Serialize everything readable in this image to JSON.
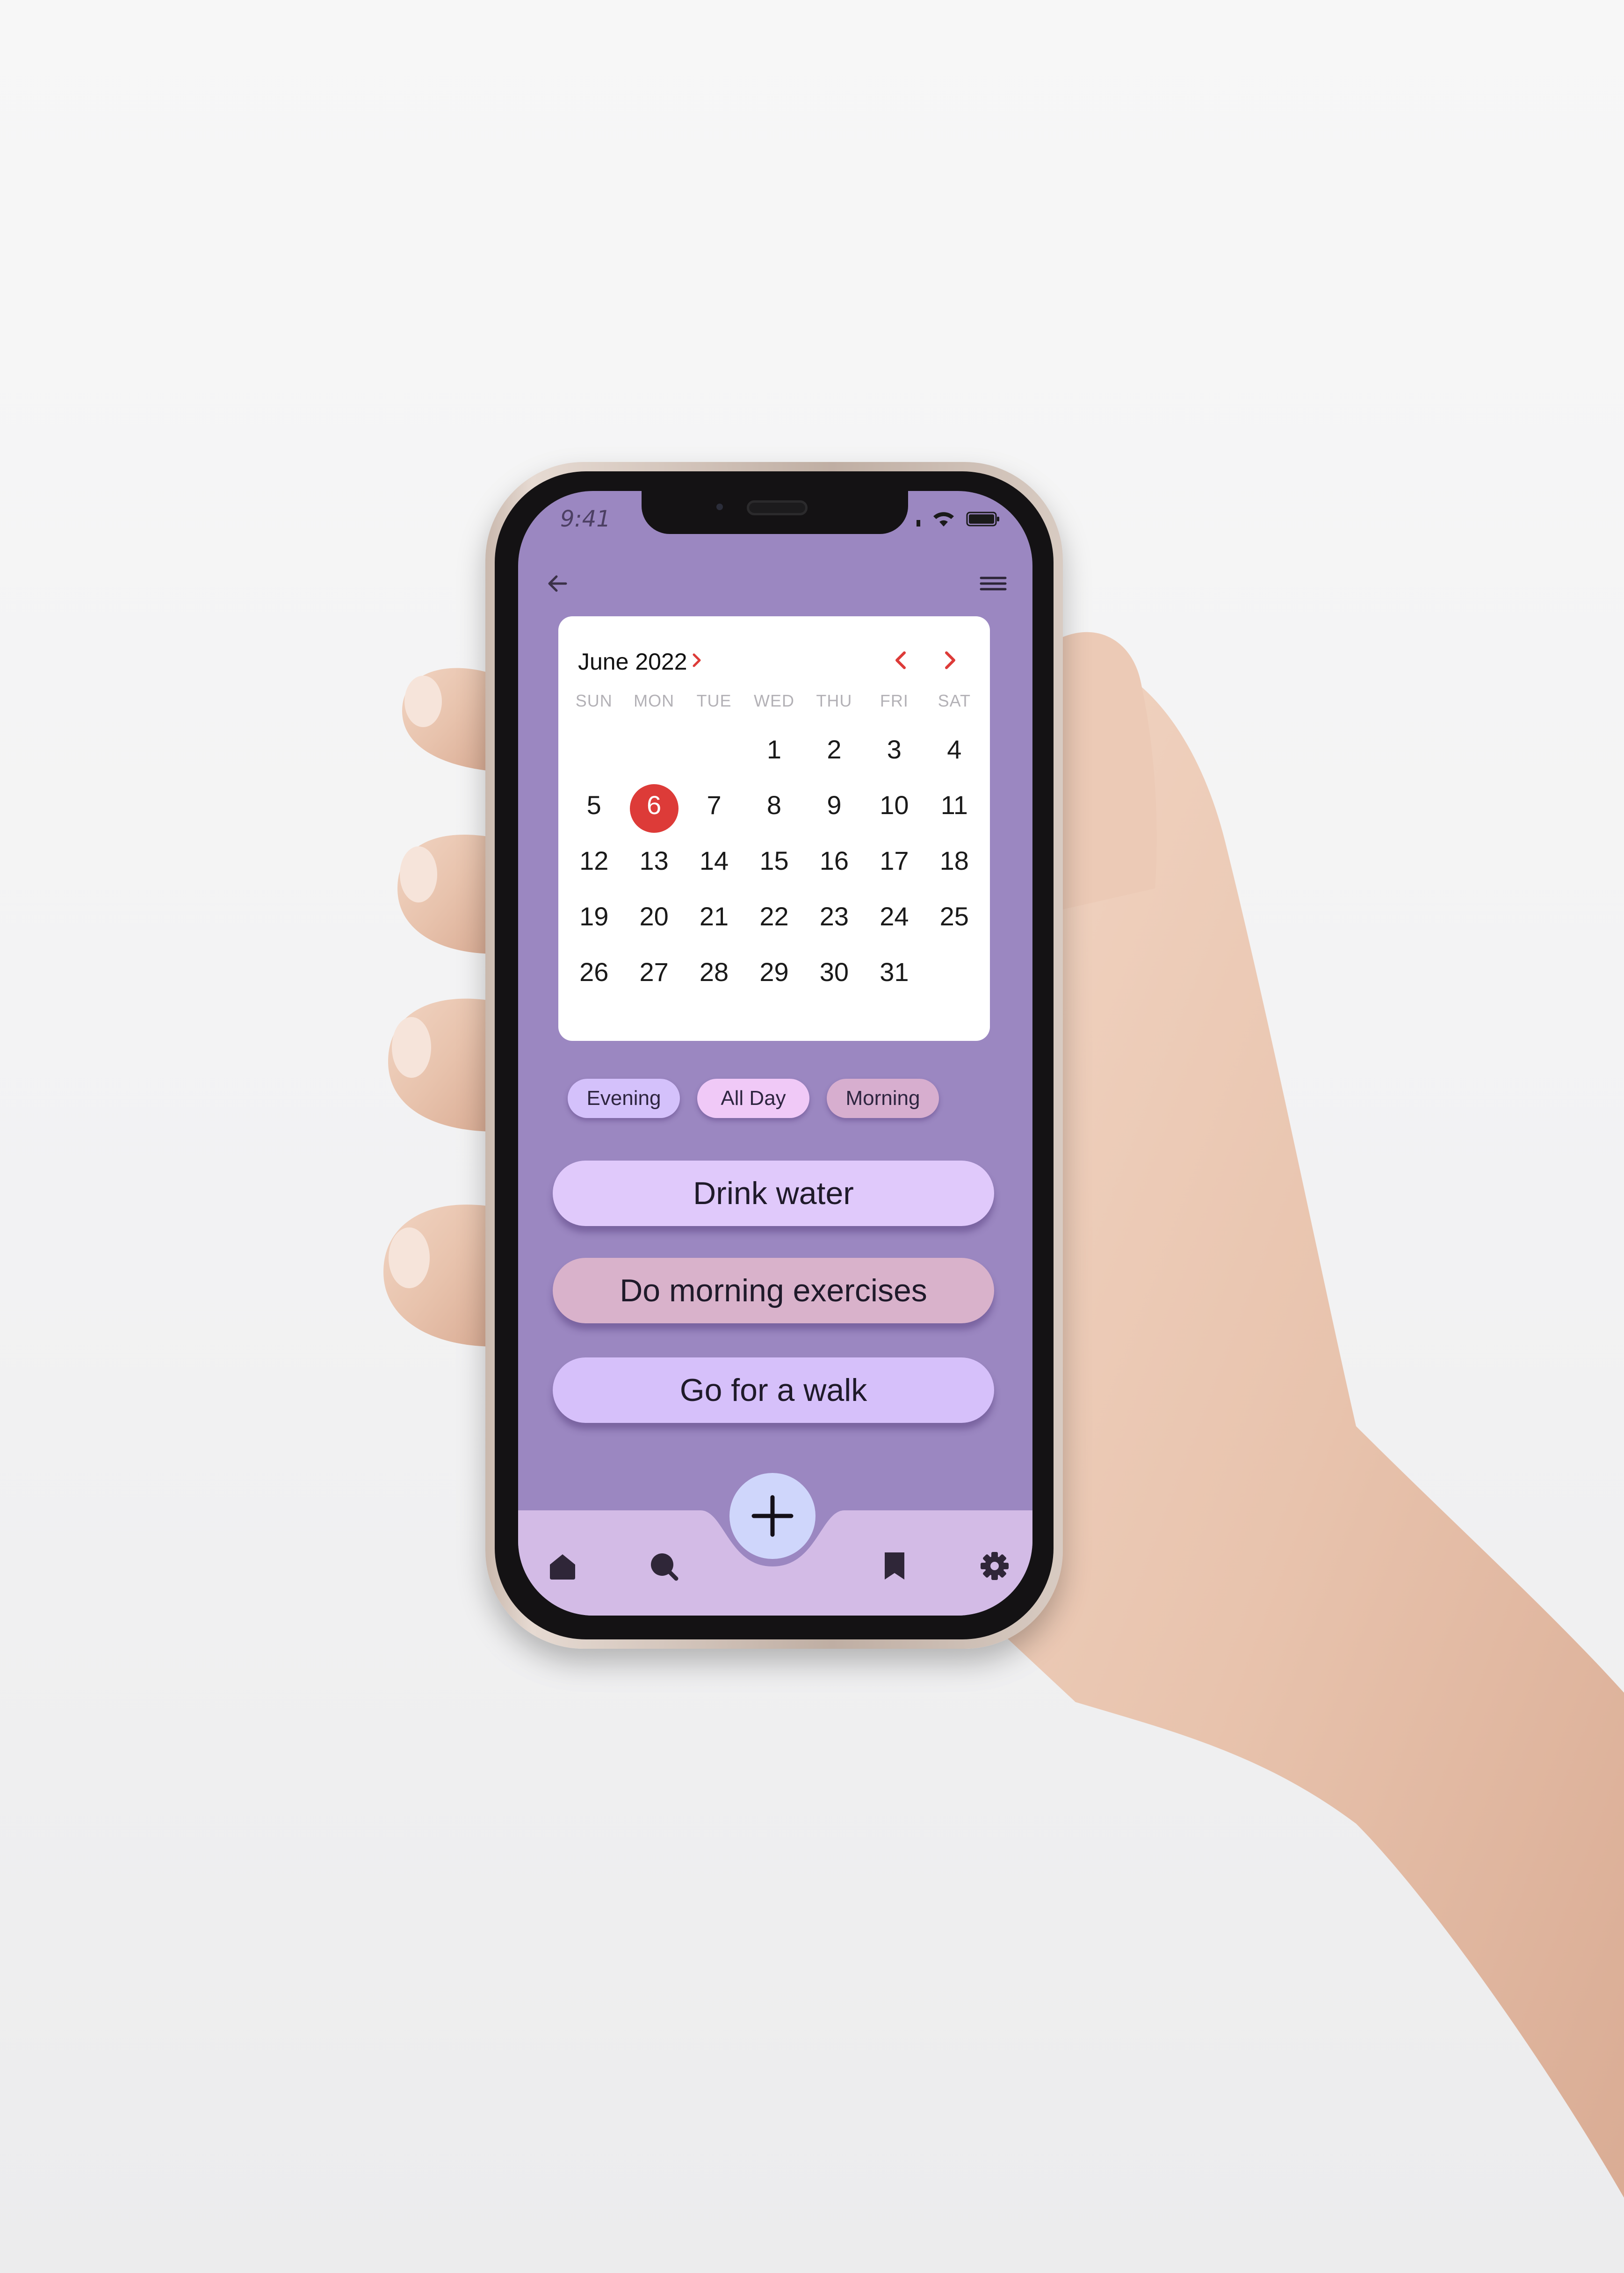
{
  "status_bar": {
    "time": "9:41"
  },
  "header": {
    "back_icon": "arrow-left-icon",
    "menu_icon": "hamburger-menu-icon"
  },
  "calendar": {
    "month_label": "June 2022",
    "weekdays": [
      "SUN",
      "MON",
      "TUE",
      "WED",
      "THU",
      "FRI",
      "SAT"
    ],
    "leading_blank_days": 3,
    "days": [
      "1",
      "2",
      "3",
      "4",
      "5",
      "6",
      "7",
      "8",
      "9",
      "10",
      "11",
      "12",
      "13",
      "14",
      "15",
      "16",
      "17",
      "18",
      "19",
      "20",
      "21",
      "22",
      "23",
      "24",
      "25",
      "26",
      "27",
      "28",
      "29",
      "30",
      "31"
    ],
    "selected_day": "6"
  },
  "filters": [
    {
      "label": "Evening",
      "color": "#d4c1fb"
    },
    {
      "label": "All Day",
      "color": "#f0c9f7"
    },
    {
      "label": "Morning",
      "color": "#d7aecf"
    }
  ],
  "tasks": [
    {
      "label": "Drink water",
      "color": "#e0c9fb"
    },
    {
      "label": "Do morning exercises",
      "color": "#d9b2cb"
    },
    {
      "label": "Go for a walk",
      "color": "#d6c0fa"
    }
  ],
  "nav": {
    "items": [
      "home-icon",
      "search-icon",
      "bookmark-icon",
      "gear-icon"
    ],
    "fab_icon": "plus-icon"
  },
  "colors": {
    "screen_bg": "#9b87c1",
    "nav_bg": "#d3bbe6",
    "accent": "#dd3b38",
    "fab_bg": "#cfd6fb"
  }
}
